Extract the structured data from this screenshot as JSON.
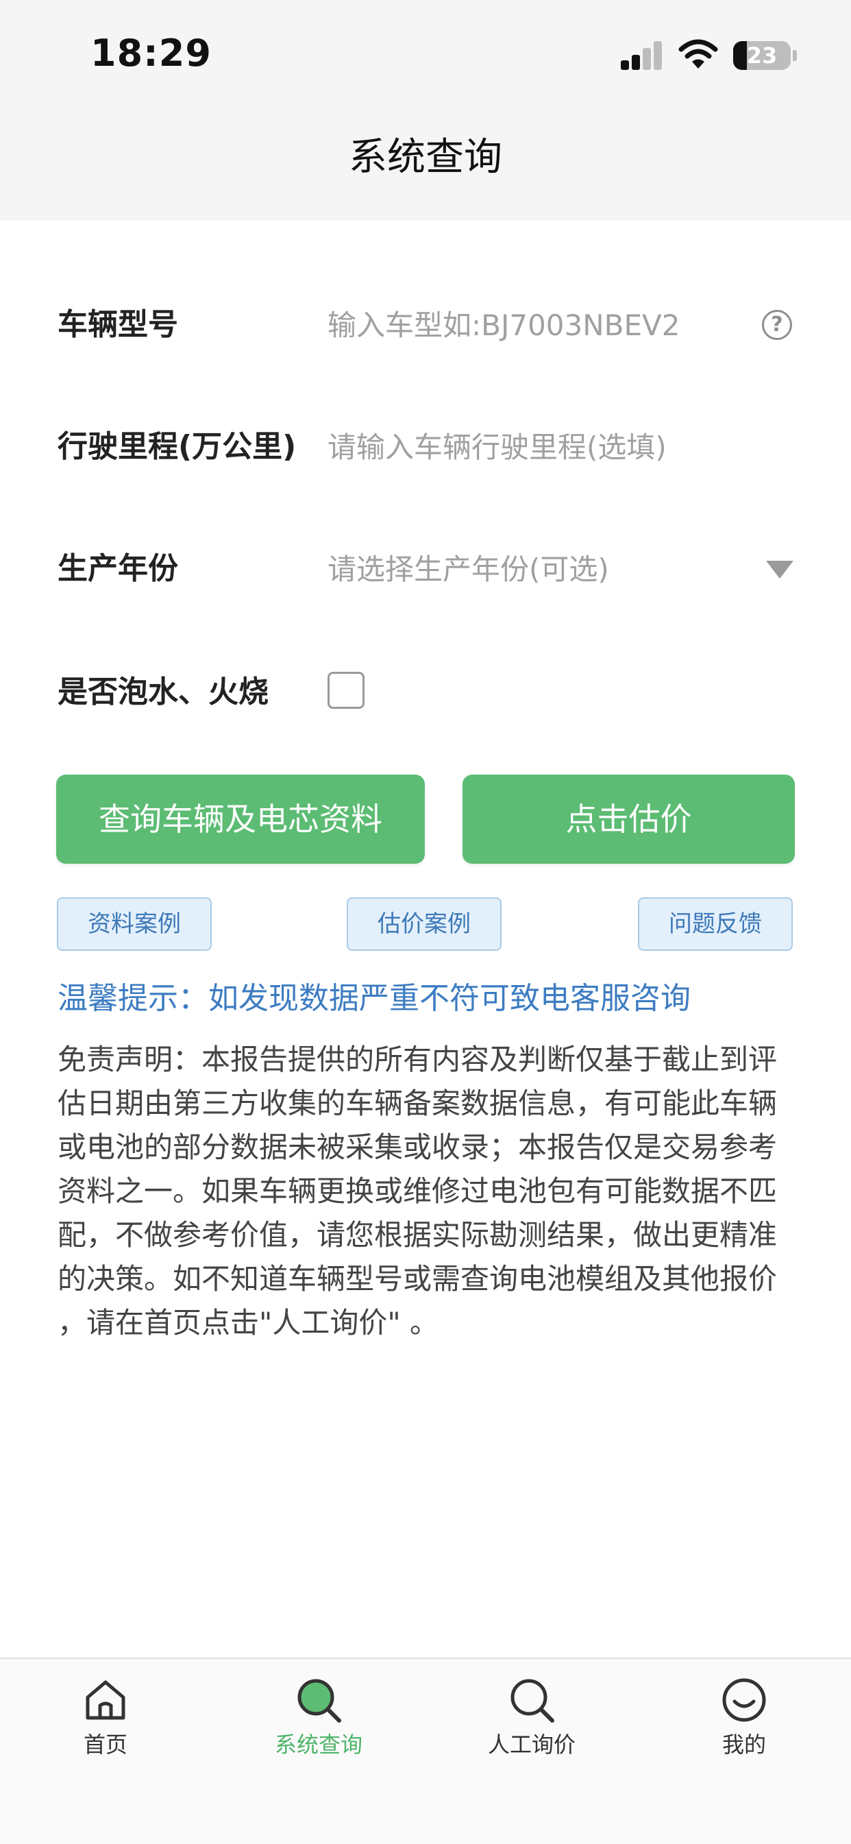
{
  "status_bar": {
    "time": "18:29",
    "battery": "23"
  },
  "header": {
    "title": "系统查询"
  },
  "form": {
    "model": {
      "label": "车辆型号",
      "placeholder": "输入车型如:BJ7003NBEV2",
      "value": ""
    },
    "mileage": {
      "label": "行驶里程(万公里)",
      "placeholder": "请输入车辆行驶里程(选填)",
      "value": ""
    },
    "year": {
      "label": "生产年份",
      "placeholder": "请选择生产年份(可选)",
      "value": ""
    },
    "flood_fire": {
      "label": "是否泡水、火烧",
      "checked": false
    }
  },
  "actions": {
    "query_label": "查询车辆及电芯资料",
    "estimate_label": "点击估价"
  },
  "links": {
    "data_cases": "资料案例",
    "estimate_cases": "估价案例",
    "feedback": "问题反馈"
  },
  "tip": "温馨提示：如发现数据严重不符可致电客服咨询",
  "disclaimer": "免责声明：本报告提供的所有内容及判断仅基于截止到评估日期由第三方收集的车辆备案数据信息，有可能此车辆或电池的部分数据未被采集或收录；本报告仅是交易参考资料之一。如果车辆更换或维修过电池包有可能数据不匹配，不做参考价值，请您根据实际勘测结果，做出更精准的决策。如不知道车辆型号或需查询电池模组及其他报价 ，请在首页点击\"人工询价\" 。",
  "tabbar": {
    "items": [
      {
        "label": "首页",
        "icon": "home-icon",
        "active": false
      },
      {
        "label": "系统查询",
        "icon": "search-icon",
        "active": true
      },
      {
        "label": "人工询价",
        "icon": "search-icon",
        "active": false
      },
      {
        "label": "我的",
        "icon": "smiley-icon",
        "active": false
      }
    ]
  },
  "colors": {
    "primary": "#5cbc73",
    "link_blue": "#3d7cc2",
    "secondary_bg": "#e3f0fb",
    "active_tab": "#4fb46a"
  }
}
